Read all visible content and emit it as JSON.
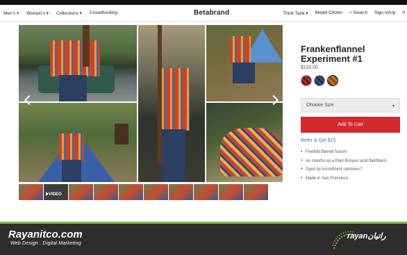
{
  "nav": {
    "left": [
      "Men's ▾",
      "Women's ▾",
      "Collections ▾",
      "Crowdfunding"
    ],
    "logo": "Betabrand",
    "right": [
      "Think Tank ▾",
      "Model Citizen",
      "⌕ Search",
      "Sign In/Up",
      "0"
    ]
  },
  "gallery": {
    "thumb_video_label": "VIDEO"
  },
  "product": {
    "title": "Frankenflannel Experiment #1",
    "price": "$118.00",
    "size_placeholder": "Choose Size",
    "cart_label": "Add To Cart",
    "refer_label": "Refer & Get $15",
    "features": [
      "Fivefold flannel fusion!",
      "As colorful as a Paul Bunyan acid flashback.",
      "Dyed by incontinent rainbows?",
      "Made in San Francisco."
    ]
  },
  "watermark": {
    "title": "Rayanitco.com",
    "subtitle": "Web Design . Digital Marketing",
    "logo_text": "rayanراتیان"
  },
  "colors": {
    "accent_red": "#d2282e",
    "link_blue": "#3d72c5",
    "footer_green": "#7ebd3c"
  }
}
